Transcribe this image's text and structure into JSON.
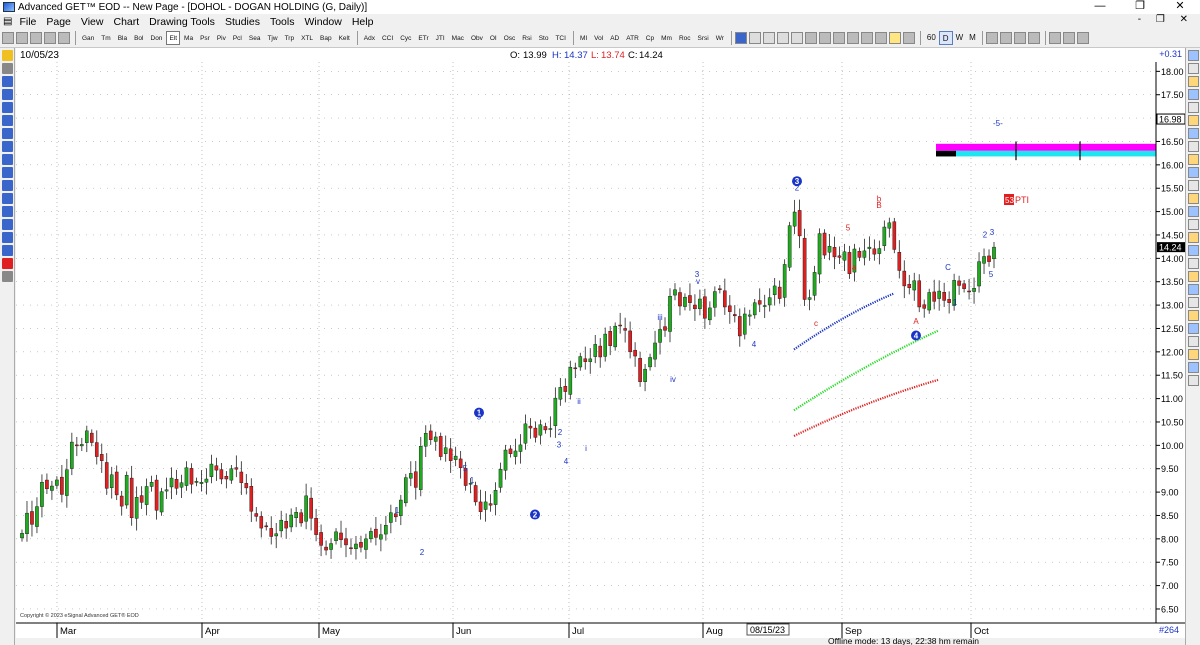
{
  "window": {
    "title": "Advanced GET™ EOD  --  New Page - [DOHOL - DOGAN HOLDING (G, Daily)]",
    "controls": [
      "—",
      "❐",
      "✕"
    ]
  },
  "menu": {
    "items": [
      "File",
      "Page",
      "View",
      "Chart",
      "Drawing Tools",
      "Studies",
      "Tools",
      "Window",
      "Help"
    ],
    "mdi": "- ❐ ✕"
  },
  "toolbar": {
    "studies": [
      "Gan",
      "Tm",
      "Bla",
      "Bol",
      "Don",
      "Elt",
      "Ma",
      "Psr",
      "Piv",
      "Pcl",
      "Sea",
      "Tjw",
      "Trp",
      "XTL",
      "Bap",
      "Kelt",
      "Adx",
      "CCI",
      "Cyc",
      "ETr",
      "JTI",
      "Mac",
      "Obv",
      "OI",
      "Osc",
      "Rsi",
      "Sto",
      "TCI",
      "MI",
      "Vol",
      "AD",
      "ATR",
      "Cp",
      "Mm",
      "Roc",
      "Srsi",
      "Wr"
    ],
    "active_study": "Elt",
    "periods": [
      "60",
      "D",
      "W",
      "M"
    ],
    "active_period": "D"
  },
  "chart": {
    "date_label": "10/05/23",
    "ohlc": {
      "o_label": "O:",
      "o": "13.99",
      "h_label": "H:",
      "h": "14.37",
      "l_label": "L:",
      "l": "13.74",
      "c_label": "C:",
      "c": "14.24"
    },
    "change": "+0.31",
    "last_price": "14.24",
    "prev_label_price": "16.98",
    "bar_count": "#264",
    "date_cursor": "08/15/23",
    "copyright": "Copyright © 2023 eSignal Advanced GET® EOD",
    "pti_label": "PTI",
    "pti_value": "53",
    "target_label": "-5-",
    "colors": {
      "up": "#1faa1f",
      "down": "#e02020",
      "wave_blue": "#1a34c8",
      "abc_red": "#e02020",
      "band_magenta": "#ff00ff",
      "band_cyan": "#1ee6f0"
    }
  },
  "chart_data": {
    "type": "candlestick",
    "x_months": [
      "Mar",
      "Apr",
      "May",
      "Jun",
      "Jul",
      "Aug",
      "Sep",
      "Oct"
    ],
    "y_ticks": [
      18.0,
      17.5,
      17.0,
      16.5,
      16.0,
      15.5,
      15.0,
      14.5,
      14.0,
      13.5,
      13.0,
      12.5,
      12.0,
      11.5,
      11.0,
      10.5,
      10.0,
      9.5,
      9.0,
      8.5,
      8.0,
      7.5,
      7.0,
      6.5
    ],
    "ylim": [
      6.2,
      18.2
    ],
    "closes": [
      8.12,
      8.55,
      8.31,
      8.69,
      9.21,
      9.07,
      9.13,
      9.26,
      8.95,
      9.48,
      10.07,
      10.0,
      10.02,
      10.31,
      10.06,
      9.76,
      9.67,
      9.08,
      9.37,
      8.94,
      8.7,
      9.36,
      8.45,
      8.89,
      8.78,
      9.12,
      9.21,
      8.61,
      9.01,
      9.05,
      9.3,
      9.08,
      9.2,
      9.52,
      9.17,
      9.23,
      9.21,
      9.28,
      9.6,
      9.47,
      9.28,
      9.28,
      9.5,
      9.49,
      9.2,
      9.09,
      8.59,
      8.48,
      8.23,
      8.26,
      8.05,
      8.11,
      8.4,
      8.23,
      8.51,
      8.57,
      8.34,
      8.92,
      8.44,
      8.09,
      7.86,
      7.76,
      7.9,
      8.15,
      7.98,
      7.87,
      7.8,
      7.89,
      7.82,
      8.0,
      8.16,
      8.03,
      8.09,
      8.29,
      8.56,
      8.47,
      8.83,
      9.31,
      9.4,
      9.1,
      9.98,
      10.26,
      10.12,
      10.18,
      9.76,
      9.95,
      9.67,
      9.77,
      9.52,
      9.14,
      9.19,
      8.79,
      8.58,
      8.79,
      8.72,
      9.04,
      9.49,
      9.9,
      9.82,
      9.88,
      10.01,
      10.46,
      10.37,
      10.17,
      10.44,
      10.33,
      10.36,
      11.01,
      11.24,
      11.15,
      11.67,
      11.64,
      11.9,
      11.79,
      11.85,
      12.16,
      11.89,
      12.38,
      12.13,
      12.55,
      12.56,
      12.46,
      12.0,
      11.91,
      11.36,
      11.63,
      11.88,
      12.19,
      12.48,
      12.46,
      13.19,
      13.33,
      12.98,
      13.17,
      13.05,
      12.92,
      13.13,
      12.72,
      12.94,
      13.29,
      13.33,
      12.96,
      12.86,
      12.77,
      12.34,
      12.81,
      12.79,
      13.05,
      13.02,
      12.99,
      13.16,
      13.41,
      13.14,
      13.87,
      14.7,
      14.99,
      14.48,
      13.12,
      13.16,
      13.7,
      14.53,
      14.07,
      14.26,
      14.03,
      14.02,
      14.14,
      13.67,
      14.2,
      14.02,
      14.16,
      14.24,
      14.09,
      14.21,
      14.67,
      14.76,
      14.19,
      13.74,
      13.41,
      13.37,
      13.52,
      12.96,
      12.93,
      13.27,
      13.08,
      13.3,
      13.1,
      13.05,
      13.53,
      13.42,
      13.35,
      13.29,
      13.36,
      13.93,
      14.04,
      13.93,
      14.24
    ],
    "wave_labels": [
      "1",
      "2",
      "3",
      "4",
      "5",
      "i",
      "ii",
      "iii",
      "iv",
      "v",
      "a",
      "b",
      "c",
      "A",
      "B",
      "C"
    ],
    "annotations": [
      "5",
      "2",
      "1",
      "2",
      "3",
      "4",
      "5",
      "1",
      "2",
      "i",
      "ii",
      "iii",
      "iv",
      "3",
      "v",
      "4",
      "5",
      "a",
      "b",
      "B",
      "c",
      "A",
      "C",
      "1",
      "2",
      "3",
      "5",
      "4"
    ]
  }
}
